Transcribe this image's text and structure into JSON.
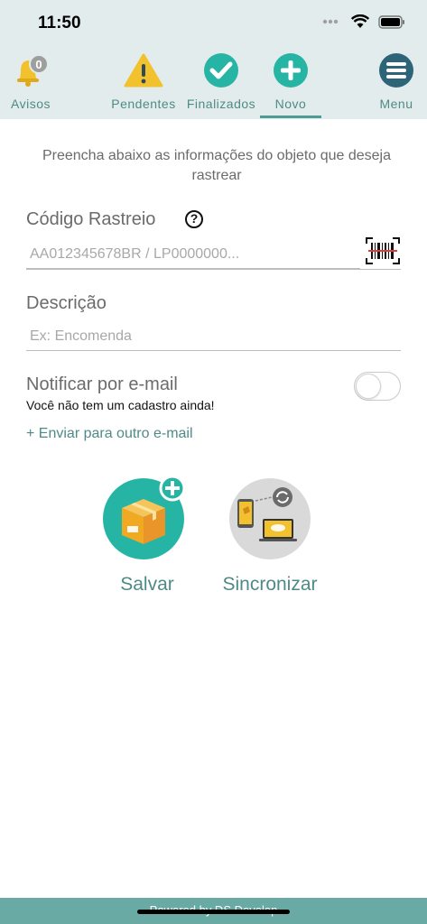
{
  "status": {
    "time": "11:50"
  },
  "nav": {
    "avisos": {
      "label": "Avisos",
      "badge": "0"
    },
    "pendentes": {
      "label": "Pendentes"
    },
    "finalizados": {
      "label": "Finalizados"
    },
    "novo": {
      "label": "Novo",
      "active": true
    },
    "menu": {
      "label": "Menu"
    }
  },
  "form": {
    "intro": "Preencha abaixo as informações do objeto que deseja rastrear",
    "codigo": {
      "label": "Código Rastreio",
      "placeholder": "AA012345678BR / LP0000000...",
      "value": ""
    },
    "descricao": {
      "label": "Descrição",
      "placeholder": "Ex: Encomenda",
      "value": ""
    },
    "notificar": {
      "label": "Notificar por e-mail",
      "sub": "Você não tem um cadastro ainda!",
      "enabled": false
    },
    "other_email_link": "+ Enviar para outro e-mail"
  },
  "actions": {
    "salvar": "Salvar",
    "sincronizar": "Sincronizar"
  },
  "footer": {
    "text": "Powered by DS Develop"
  },
  "colors": {
    "accent": "#4f8b86",
    "header_bg": "#e3ecec",
    "footer_bg": "#6aaaa4",
    "teal_icon": "#26b5a5",
    "warning": "#f2c12e",
    "menu_icon": "#2e6478"
  }
}
